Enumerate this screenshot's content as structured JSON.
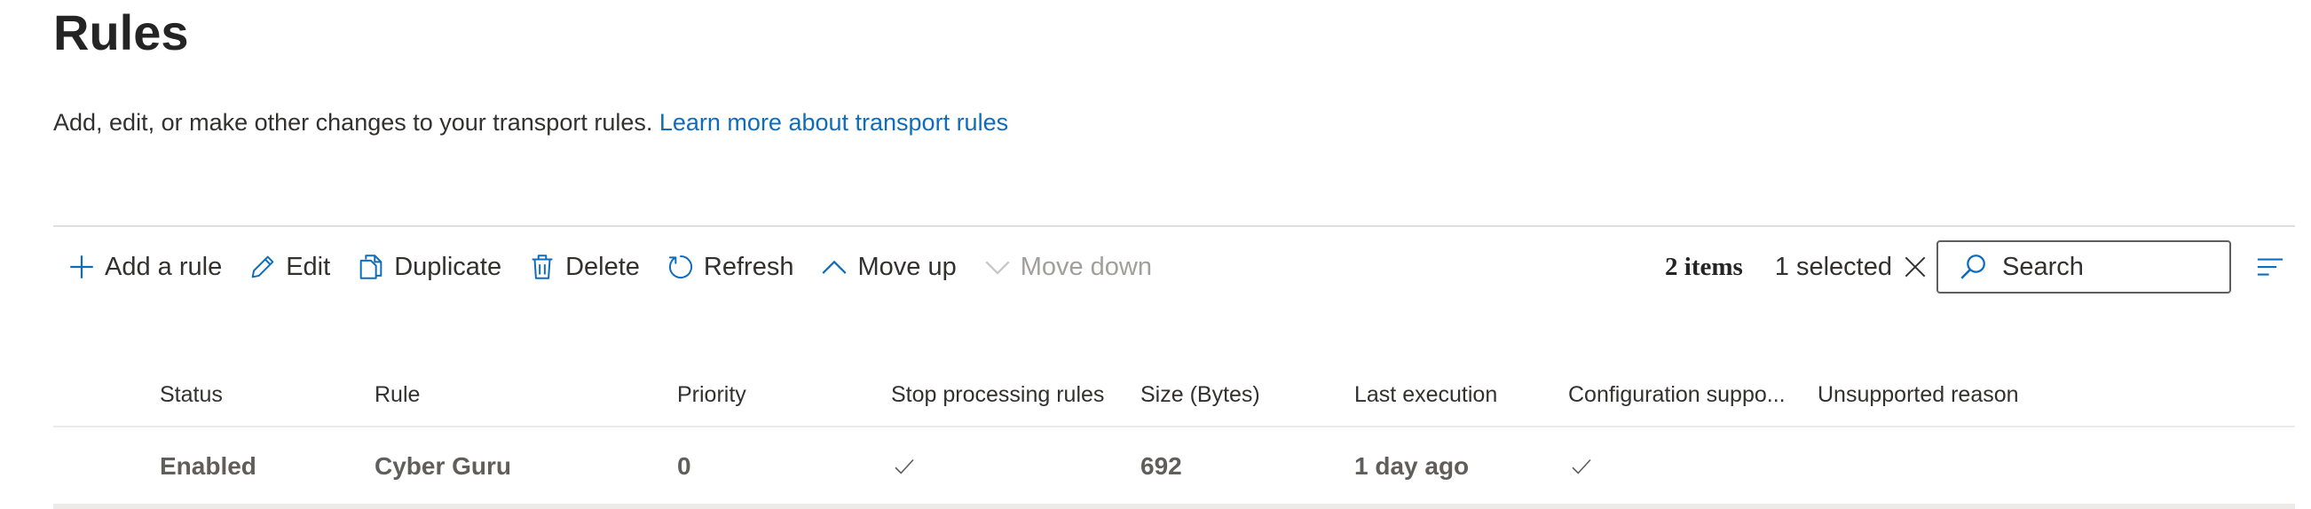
{
  "page": {
    "title": "Rules",
    "description": "Add, edit, or make other changes to your transport rules.",
    "learn_more_link": "Learn more about transport rules"
  },
  "toolbar": {
    "add": "Add a rule",
    "edit": "Edit",
    "duplicate": "Duplicate",
    "delete": "Delete",
    "refresh": "Refresh",
    "move_up": "Move up",
    "move_down": "Move down",
    "items_count": "2 items",
    "selected": "1 selected",
    "search_placeholder": "Search"
  },
  "table": {
    "columns": {
      "status": "Status",
      "rule": "Rule",
      "priority": "Priority",
      "stop_processing": "Stop processing rules",
      "size": "Size (Bytes)",
      "last_execution": "Last execution",
      "config_supported": "Configuration suppo...",
      "unsupported_reason": "Unsupported reason"
    },
    "rows": [
      {
        "status": "Enabled",
        "rule": "Cyber Guru",
        "priority": "0",
        "stop_processing": true,
        "size": "692",
        "last_execution": "1 day ago",
        "config_supported": true,
        "unsupported_reason": ""
      }
    ]
  },
  "icons": {
    "add": "plus-icon",
    "edit": "pencil-icon",
    "duplicate": "copy-icon",
    "delete": "trash-icon",
    "refresh": "refresh-icon",
    "move_up": "chevron-up-icon",
    "move_down": "chevron-down-icon",
    "clear": "close-icon",
    "search": "search-icon",
    "view": "view-options-icon",
    "check": "checkmark-icon"
  },
  "colors": {
    "accent": "#0f6cbd",
    "text": "#323130",
    "disabled": "#a19f9d"
  }
}
